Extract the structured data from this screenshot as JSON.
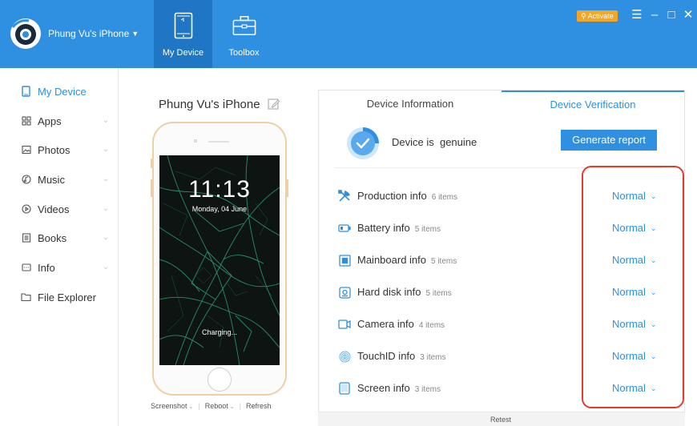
{
  "app": {
    "device_name": "Phung Vu's iPhone",
    "activate_label": "Activate"
  },
  "nav_tabs": [
    {
      "label": "My Device",
      "icon": "tablet-icon",
      "active": true
    },
    {
      "label": "Toolbox",
      "icon": "toolbox-icon",
      "active": false
    }
  ],
  "window_controls": [
    "menu-icon",
    "minimize-icon",
    "maximize-icon",
    "close-icon"
  ],
  "sidebar": {
    "items": [
      {
        "label": "My Device",
        "icon": "device-icon",
        "active": true,
        "expandable": false
      },
      {
        "label": "Apps",
        "icon": "apps-icon",
        "active": false,
        "expandable": true
      },
      {
        "label": "Photos",
        "icon": "photos-icon",
        "active": false,
        "expandable": true
      },
      {
        "label": "Music",
        "icon": "music-icon",
        "active": false,
        "expandable": true
      },
      {
        "label": "Videos",
        "icon": "videos-icon",
        "active": false,
        "expandable": true
      },
      {
        "label": "Books",
        "icon": "books-icon",
        "active": false,
        "expandable": true
      },
      {
        "label": "Info",
        "icon": "info-icon",
        "active": false,
        "expandable": true
      },
      {
        "label": "File Explorer",
        "icon": "folder-icon",
        "active": false,
        "expandable": false
      }
    ]
  },
  "device": {
    "title": "Phung Vu's iPhone",
    "lock_time": "11:13",
    "lock_date": "Monday, 04 June",
    "charging_text": "Charging...",
    "actions": {
      "screenshot": "Screenshot",
      "reboot": "Reboot",
      "refresh": "Refresh"
    }
  },
  "panel": {
    "tabs": [
      "Device Information",
      "Device Verification"
    ],
    "active_tab": "Device Verification",
    "genuine_text": "Device is  genuine",
    "report_button": "Generate report",
    "rows": [
      {
        "label": "Production info",
        "count": "6 items",
        "status": "Normal",
        "icon": "tools-icon"
      },
      {
        "label": "Battery info",
        "count": "5 items",
        "status": "Normal",
        "icon": "battery-icon"
      },
      {
        "label": "Mainboard info",
        "count": "5 items",
        "status": "Normal",
        "icon": "mainboard-icon"
      },
      {
        "label": "Hard disk info",
        "count": "5 items",
        "status": "Normal",
        "icon": "hard-disk-icon"
      },
      {
        "label": "Camera info",
        "count": "4 items",
        "status": "Normal",
        "icon": "camera-icon"
      },
      {
        "label": "TouchID info",
        "count": "3 items",
        "status": "Normal",
        "icon": "fingerprint-icon"
      },
      {
        "label": "Screen info",
        "count": "3 items",
        "status": "Normal",
        "icon": "screen-icon"
      }
    ],
    "retest_label": "Retest"
  },
  "colors": {
    "topbar": "#2f8fe0",
    "active_tab": "#1f76c4",
    "accent": "#2f8fe0",
    "activate": "#f5a623",
    "highlight": "#e33b2e"
  }
}
